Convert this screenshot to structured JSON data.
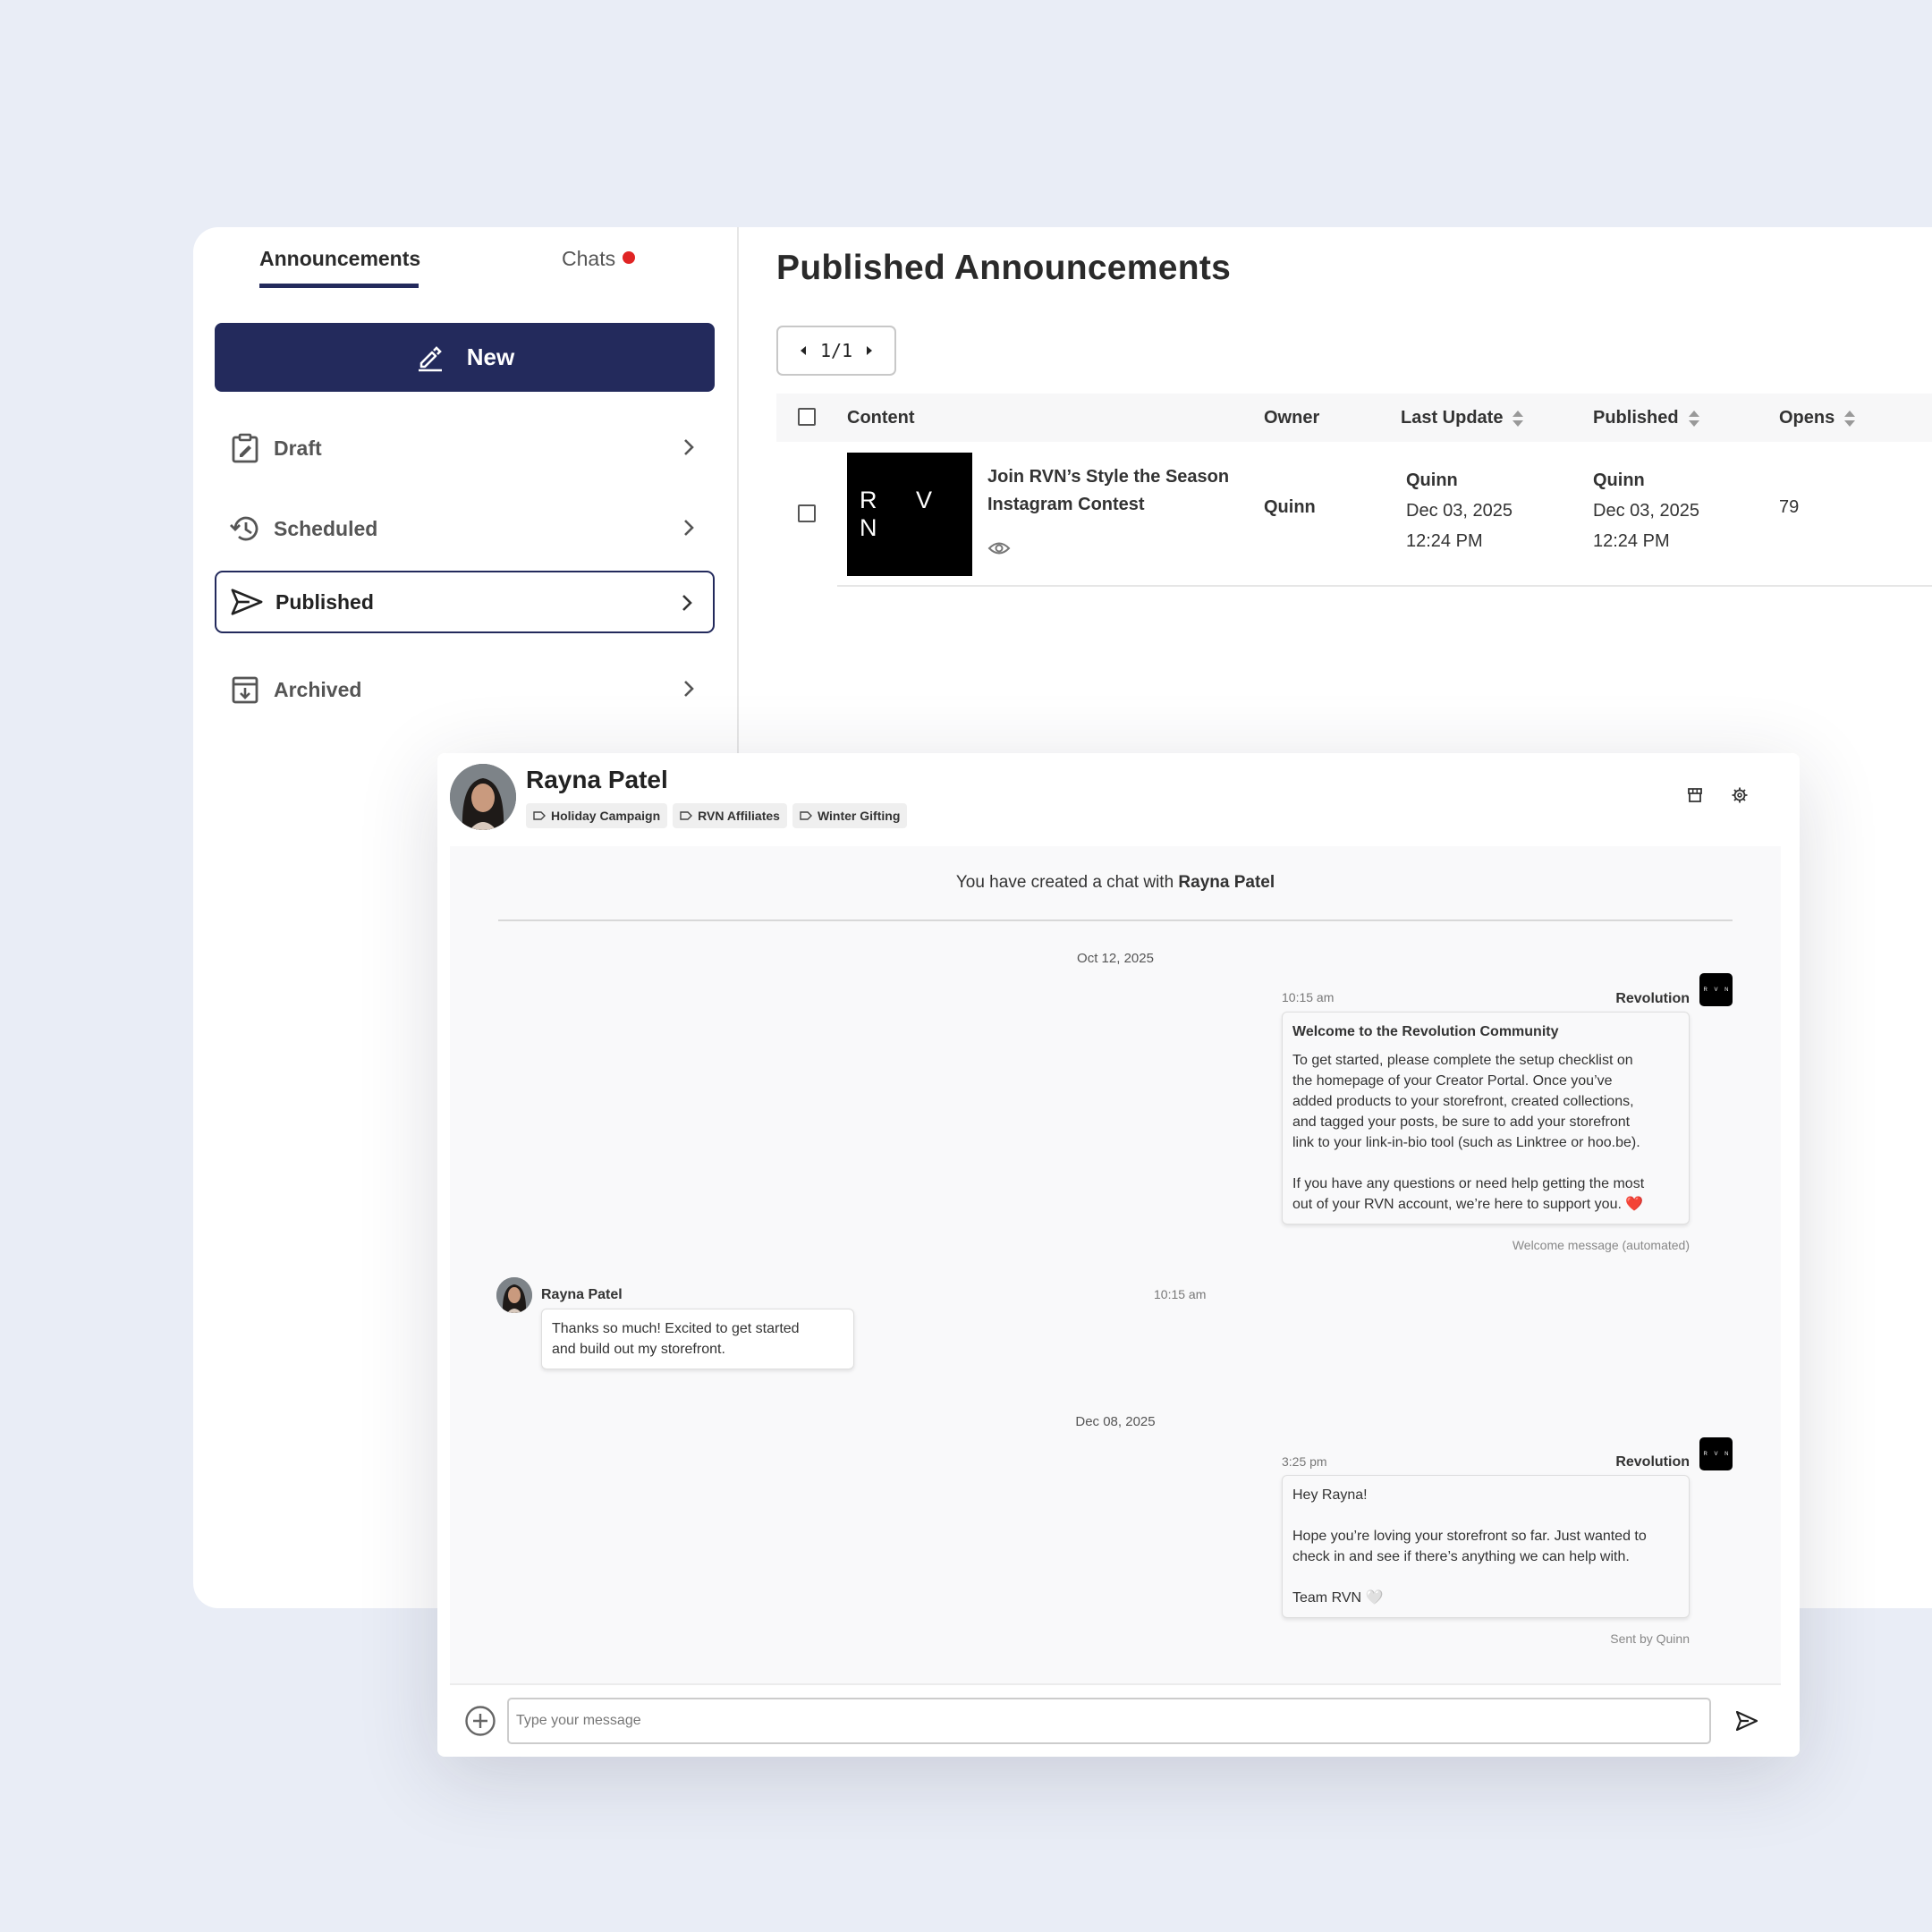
{
  "sidebar": {
    "tabs": {
      "announcements": "Announcements",
      "chats": "Chats"
    },
    "new_button": "New",
    "items": [
      {
        "label": "Draft",
        "icon": "clipboard-edit-icon"
      },
      {
        "label": "Scheduled",
        "icon": "history-icon"
      },
      {
        "label": "Published",
        "icon": "send-icon",
        "active": true
      },
      {
        "label": "Archived",
        "icon": "archive-icon"
      }
    ]
  },
  "main": {
    "title": "Published Announcements",
    "pager": "1/1",
    "table": {
      "headers": {
        "content": "Content",
        "owner": "Owner",
        "last_update": "Last Update",
        "published": "Published",
        "opens": "Opens"
      },
      "rows": [
        {
          "thumb": "R V N",
          "title_line1": "Join RVN’s Style the Season",
          "title_line2": "Instagram Contest",
          "owner": "Quinn",
          "last_update_by": "Quinn",
          "last_update_date": "Dec 03, 2025",
          "last_update_time": "12:24 PM",
          "published_by": "Quinn",
          "published_date": "Dec 03, 2025",
          "published_time": "12:24 PM",
          "opens": "79"
        }
      ]
    }
  },
  "chat": {
    "name": "Rayna Patel",
    "tags": [
      "Holiday Campaign",
      "RVN Affiliates",
      "Winter Gifting"
    ],
    "created_prefix": "You have created a chat with ",
    "created_name": "Rayna Patel",
    "dates": [
      "Oct 12, 2025",
      "Dec 08, 2025"
    ],
    "messages": [
      {
        "time": "10:15 am",
        "sender": "Revolution",
        "badge": "R V N",
        "title": "Welcome to the Revolution Community",
        "lines": [
          "To get started, please complete the setup checklist on",
          "the homepage of your Creator Portal. Once you’ve",
          "added products to your storefront, created collections,",
          "and tagged your posts, be sure to add your storefront",
          "link to your link-in-bio tool (such as Linktree or hoo.be)."
        ],
        "lines2": [
          "If you have any questions or need help getting the most",
          "out of your RVN account, we’re here to support you. ❤️"
        ],
        "footer": "Welcome message (automated)"
      },
      {
        "time": "10:15 am",
        "sender": "Rayna Patel",
        "lines": [
          "Thanks so much! Excited to get started",
          "and build out my storefront."
        ]
      },
      {
        "time": "3:25 pm",
        "sender": "Revolution",
        "badge": "R V N",
        "greeting": "Hey Rayna!",
        "lines": [
          "Hope you’re loving your storefront so far. Just wanted to",
          "check in and see if there’s anything we can help with."
        ],
        "signoff": "Team RVN 🤍",
        "footer": "Sent by Quinn"
      }
    ],
    "composer_placeholder": "Type your message"
  },
  "colors": {
    "accent": "#232a5c",
    "notification": "#e02424",
    "background": "#e9edf6"
  }
}
